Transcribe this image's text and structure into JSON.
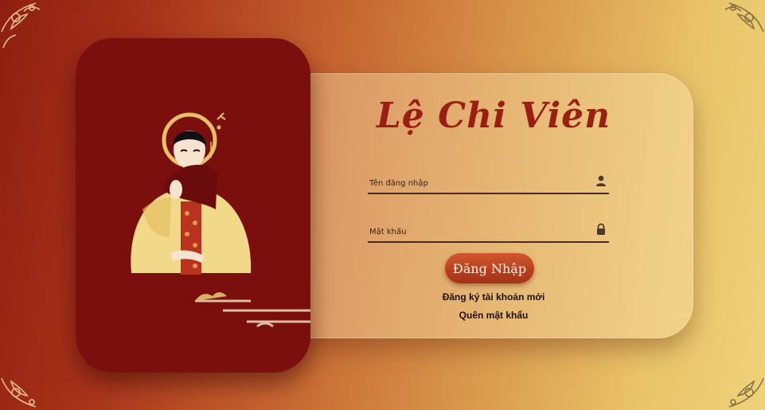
{
  "app": {
    "brand_title": "Lệ Chi Viên"
  },
  "login_form": {
    "username_placeholder": "Tên đăng nhập",
    "password_placeholder": "Mật khẩu",
    "username_icon": "user-icon",
    "password_icon": "lock-icon",
    "submit_label": "Đăng Nhập",
    "register_link": "Đăng ký tài khoản mới",
    "forgot_link": "Quên mật khẩu"
  },
  "theme": {
    "primary_red": "#7a0f0d",
    "title_red": "#9b1e14",
    "button_orange": "#b8401f",
    "gold": "#e9c46a"
  }
}
